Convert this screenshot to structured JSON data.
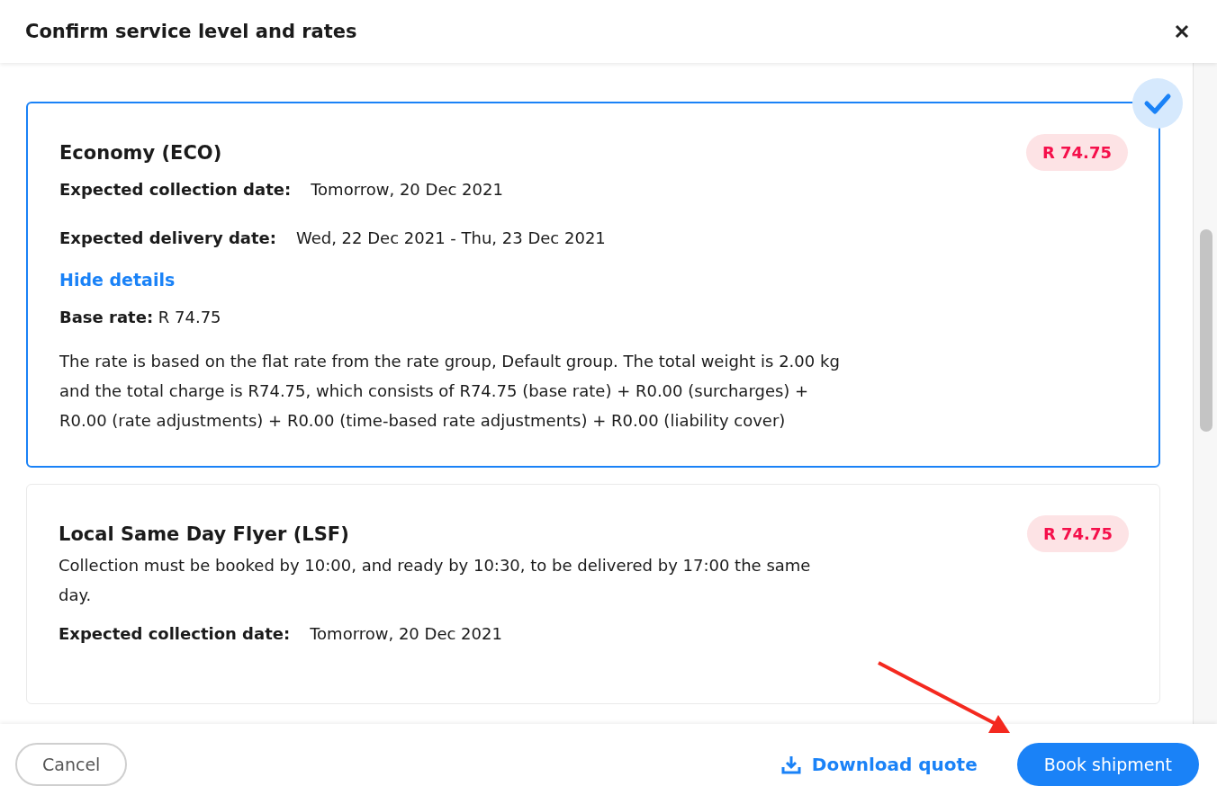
{
  "dialog": {
    "title": "Confirm service level and rates"
  },
  "services": [
    {
      "name": "Economy (ECO)",
      "selected": true,
      "price": "R 74.75",
      "fields": [
        {
          "label": "Expected collection date:",
          "value": "Tomorrow, 20 Dec 2021"
        },
        {
          "label": "Expected delivery date:",
          "value": "Wed, 22 Dec 2021 - Thu, 23 Dec 2021"
        }
      ],
      "details_link": "Hide details",
      "base_rate": "**Base rate:** R 74.75",
      "details_text": "The rate is based on the flat rate from the rate group, Default group. The total weight is 2.00 kg and the total charge is R74.75, which consists of R74.75 (base rate) + R0.00 (surcharges) + R0.00 (rate adjustments) + R0.00 (time-based rate adjustments) + R0.00 (liability cover)"
    },
    {
      "name": "Local Same Day Flyer (LSF)",
      "selected": false,
      "price": "R 74.75",
      "description": "Collection must be booked by 10:00, and ready by 10:30, to be delivered by 17:00 the same day.",
      "fields": [
        {
          "label": "Expected collection date:",
          "value": "Tomorrow, 20 Dec 2021"
        }
      ]
    }
  ],
  "footer": {
    "cancel": "Cancel",
    "download": "Download quote",
    "book": "Book shipment"
  }
}
